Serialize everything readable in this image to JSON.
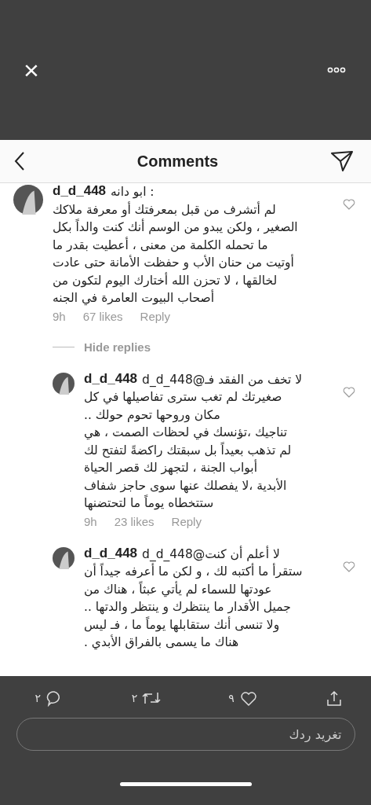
{
  "viewer_bar": {
    "close": "×"
  },
  "post_image": {
    "header": {
      "title": "Comments"
    },
    "comments": [
      {
        "kind": "comment",
        "username": "d_d_448",
        "lines": [
          ": ابو دانه",
          "لم أتشرف من قبل بمعرفتك أو معرفة ملاكك",
          "الصغير ، ولكن يبدو من الوسم أنك كنت والداً بكل",
          "ما تحمله الكلمة من معنى ، أعطيت بقدر ما",
          "أوتيت من حنان الأب و حفظت الأمانة حتى عادت",
          "لخالقها ، لا تحزن الله أختارك اليوم لتكون من",
          "أصحاب البيوت العامرة في الجنه"
        ],
        "time": "9h",
        "likes": "67 likes",
        "reply": "Reply",
        "replies_toggle": "Hide replies"
      },
      {
        "kind": "reply",
        "username": "d_d_448",
        "lines": [
          "لا تخف من الفقد فـ@d_d_448",
          "صغيرتك لم تغب سترى تفاصيلها في كل",
          "مكان وروحها تحوم حولك ..",
          "تناجيك ،تؤنسك في لحظات الصمت ، هي",
          "لم تذهب بعيداً بل سبقتك راكضةً لتفتح لك",
          "أبواب الجنة ، لتجهز لك قصر الحياة",
          "الأبدية ،لا يفصلك عنها سوى حاجز  شفاف",
          "ستتخطاه يوماً ما لتحتضنها"
        ],
        "time": "9h",
        "likes": "23 likes",
        "reply": "Reply"
      },
      {
        "kind": "reply",
        "username": "d_d_448",
        "lines": [
          "لا أعلم أن كنت@d_d_448",
          "ستقرأ ما أكتبه لك ، و لكن ما أعرفه جيداً أن",
          "عودتها للسماء لم يأتي عبثاً ، هناك من",
          "جميل الأقدار ما ينتظرك و ينتظر والدتها ..",
          "ولا تنسى أنك ستقابلها يوماً ما ، فـ ليس",
          "هناك ما يسمى بالفراق الأبدي ."
        ]
      }
    ]
  },
  "actions": [
    {
      "kind": "share"
    },
    {
      "kind": "like",
      "count": "٩"
    },
    {
      "kind": "retweet",
      "count": "٢"
    },
    {
      "kind": "reply",
      "count": "٢"
    }
  ],
  "reply_field": {
    "placeholder": "تغريد ردك"
  }
}
